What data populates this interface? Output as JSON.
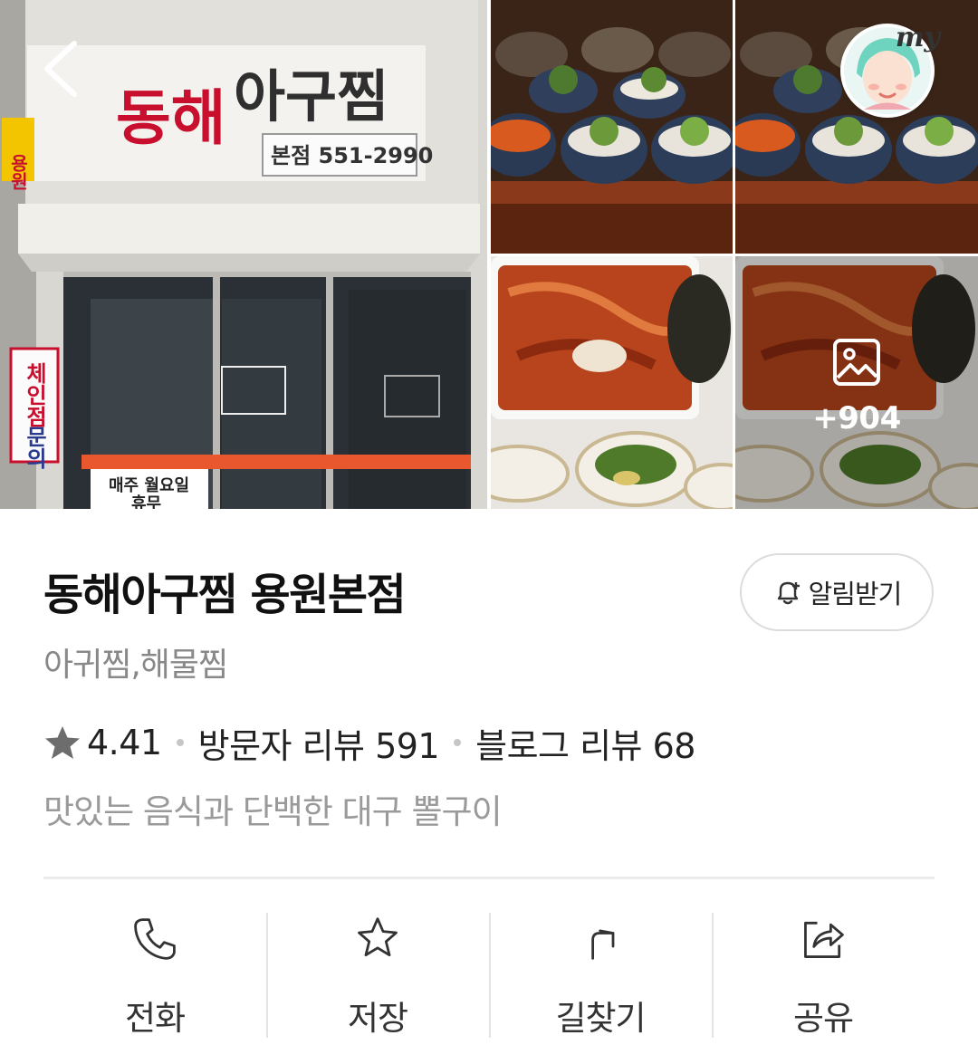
{
  "gallery": {
    "storefront_sign": {
      "brand_main": "동해아구찜",
      "brand_sub": "용원",
      "phone": "본점 551-2990",
      "side_banner_1": "체인점",
      "side_banner_2": "문의",
      "door_notice": "매주 월요일",
      "door_notice_2": "휴무"
    },
    "more_photos_count": "+904"
  },
  "place": {
    "name": "동해아구찜 용원본점",
    "category": "아귀찜,해물찜",
    "rating": "4.41",
    "visitor_reviews": "방문자 리뷰 591",
    "blog_reviews": "블로그 리뷰 68",
    "description": "맛있는 음식과 단백한 대구 뽈구이"
  },
  "alarm": {
    "label": "알림받기"
  },
  "my": {
    "label": "my"
  },
  "actions": {
    "call": "전화",
    "save": "저장",
    "directions": "길찾기",
    "share": "공유"
  },
  "colors": {
    "sign_red": "#c8102e",
    "muted_text": "#888888",
    "divider": "#ececec"
  }
}
